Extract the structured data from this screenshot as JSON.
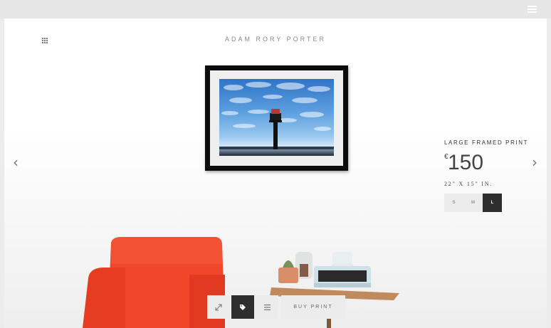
{
  "header": {
    "menu_icon": "hamburger-icon"
  },
  "nav": {
    "grid_icon": "grid-icon",
    "prev_icon": "chevron-left-icon",
    "next_icon": "chevron-right-icon"
  },
  "artist_name": "ADAM RORY PORTER",
  "print": {
    "type": "LARGE FRAMED PRINT",
    "currency": "€",
    "price": "150",
    "dimensions": "22\" X 15\" IN.",
    "sizes": [
      "S",
      "M",
      "L"
    ],
    "selected_size": "L"
  },
  "toolbar": {
    "expand_icon": "expand-icon",
    "tag_icon": "tag-icon",
    "list_icon": "list-icon",
    "buy_label": "BUY PRINT"
  },
  "colors": {
    "active_button": "#2e2e2e",
    "chair": "#f0462a",
    "table_top": "#c08a5c"
  }
}
